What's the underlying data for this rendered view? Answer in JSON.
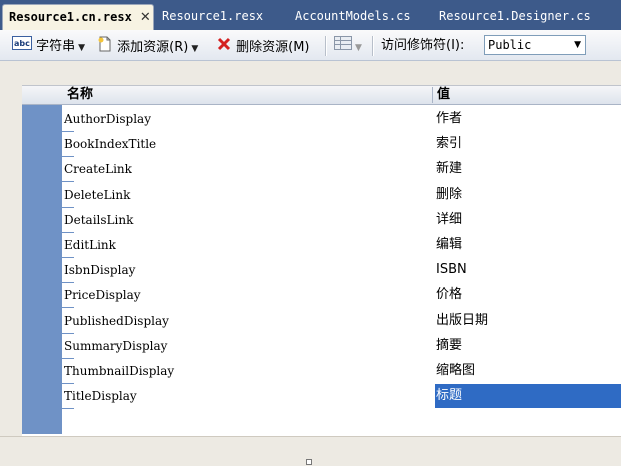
{
  "tabs": [
    {
      "label": "Resource1.cn.resx",
      "active": true,
      "close": "✕"
    },
    {
      "label": "Resource1.resx",
      "active": false
    },
    {
      "label": "AccountModels.cs",
      "active": false
    },
    {
      "label": "Resource1.Designer.cs",
      "active": false
    }
  ],
  "toolbar": {
    "strings_label": "字符串",
    "add_resource_label": "添加资源(R)",
    "remove_resource_label": "删除资源(M)",
    "access_modifier_label": "访问修饰符(I):",
    "access_modifier_value": "Public"
  },
  "grid": {
    "col_name_header": "名称",
    "col_value_header": "值",
    "rows": [
      {
        "name": "AuthorDisplay",
        "value": "作者"
      },
      {
        "name": "BookIndexTitle",
        "value": "索引"
      },
      {
        "name": "CreateLink",
        "value": "新建"
      },
      {
        "name": "DeleteLink",
        "value": "删除"
      },
      {
        "name": "DetailsLink",
        "value": "详细"
      },
      {
        "name": "EditLink",
        "value": "编辑"
      },
      {
        "name": "IsbnDisplay",
        "value": "ISBN"
      },
      {
        "name": "PriceDisplay",
        "value": "价格"
      },
      {
        "name": "PublishedDisplay",
        "value": "出版日期"
      },
      {
        "name": "SummaryDisplay",
        "value": "摘要"
      },
      {
        "name": "ThumbnailDisplay",
        "value": "缩略图"
      },
      {
        "name": "TitleDisplay",
        "value": "标题",
        "selected": true
      }
    ]
  },
  "colors": {
    "tab_strip": "#3d5a8a",
    "active_tab": "#f7f3e3",
    "selection": "#2f6bc4",
    "row_selector": "#6f92c6"
  },
  "icons": [
    "abc-strings-icon",
    "add-resource-icon",
    "remove-resource-icon",
    "views-icon",
    "chevron-down-icon"
  ]
}
